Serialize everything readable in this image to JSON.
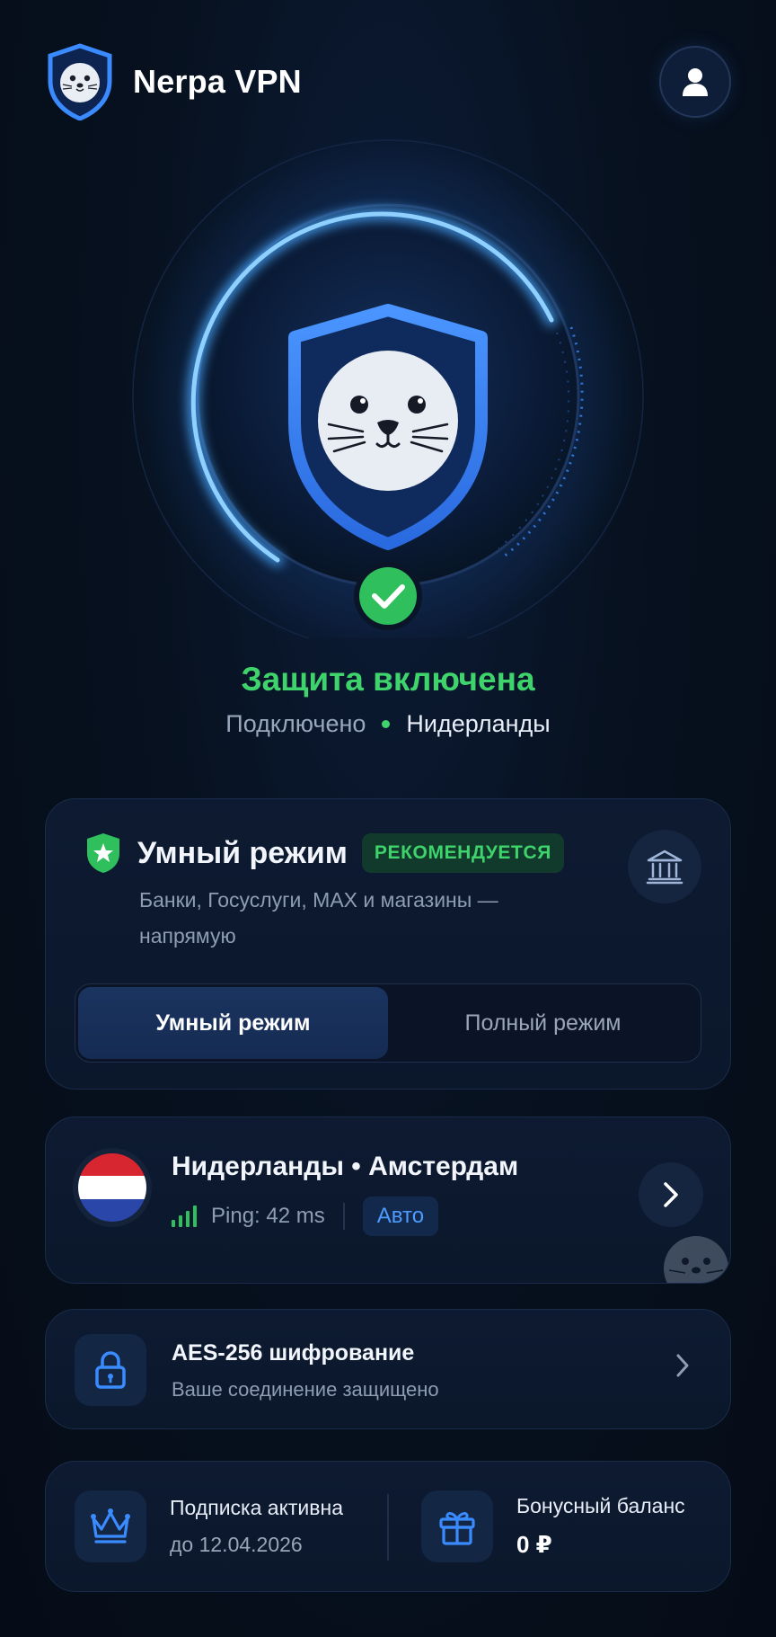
{
  "app": {
    "name": "Nerpa VPN"
  },
  "icons": {
    "logo": "seal-shield-icon",
    "profile": "user-icon",
    "bank": "bank-icon",
    "lock": "lock-icon",
    "crown": "crown-icon",
    "gift": "gift-icon",
    "chevron": "chevron-right-icon",
    "check": "check-icon",
    "star": "star-shield-icon",
    "signal": "signal-bars-icon"
  },
  "colors": {
    "accent": "#3a8bff",
    "success": "#3ed36b",
    "background": "#07111f"
  },
  "status": {
    "title": "Защита включена",
    "connection": "Подключено",
    "location": "Нидерланды"
  },
  "smart_mode": {
    "title": "Умный режим",
    "badge": "РЕКОМЕНДУЕТСЯ",
    "description": "Банки, Госуслуги, MAX и магазины — напрямую",
    "segments": [
      {
        "label": "Умный режим",
        "active": true
      },
      {
        "label": "Полный режим",
        "active": false
      }
    ]
  },
  "server": {
    "name": "Нидерланды • Амстердам",
    "ping": "Ping: 42 ms",
    "mode": "Авто",
    "flag_colors": [
      "#d7262f",
      "#ffffff",
      "#2a46a8"
    ]
  },
  "encryption": {
    "title": "AES-256 шифрование",
    "subtitle": "Ваше соединение защищено"
  },
  "subscription": {
    "title": "Подписка активна",
    "until": "до 12.04.2026"
  },
  "bonus": {
    "title": "Бонусный баланс",
    "value": "0 ₽"
  }
}
